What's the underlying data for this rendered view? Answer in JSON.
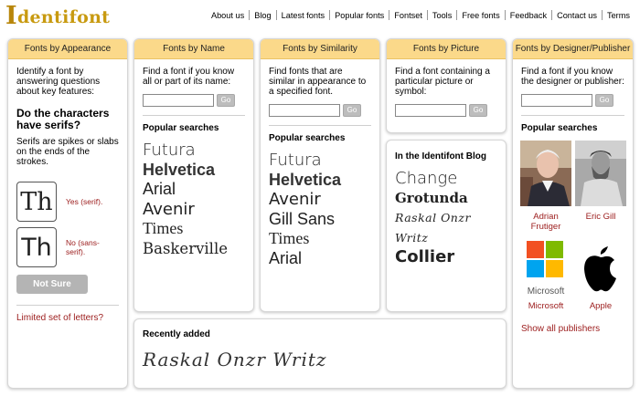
{
  "header": {
    "logo": "Identifont",
    "nav": [
      "About us",
      "Blog",
      "Latest fonts",
      "Popular fonts",
      "Fontset",
      "Tools",
      "Free fonts",
      "Feedback",
      "Contact us",
      "Terms"
    ]
  },
  "appearance": {
    "title": "Fonts by Appearance",
    "intro": "Identify a font by answering questions about key features:",
    "question": "Do the characters have serifs?",
    "definition": "Serifs are spikes or slabs on the ends of the strokes.",
    "sample_text": "Th",
    "yes_label": "Yes (serif).",
    "no_label": "No (sans-serif).",
    "not_sure": "Not Sure",
    "limited_link": "Limited set of letters?"
  },
  "name": {
    "title": "Fonts by Name",
    "intro": "Find a font if you know all or part of its name:",
    "go": "Go",
    "popular_title": "Popular searches",
    "popular": [
      "Futura",
      "Helvetica",
      "Arial",
      "Avenir",
      "Times",
      "Baskerville"
    ]
  },
  "similarity": {
    "title": "Fonts by Similarity",
    "intro": "Find fonts that are similar in appearance to a specified font.",
    "go": "Go",
    "popular_title": "Popular searches",
    "popular": [
      "Futura",
      "Helvetica",
      "Avenir",
      "Gill Sans",
      "Times",
      "Arial"
    ]
  },
  "picture": {
    "title": "Fonts by Picture",
    "intro": "Find a font containing a particular picture or symbol:",
    "go": "Go"
  },
  "blog": {
    "title": "In the Identifont Blog",
    "items": [
      "Change",
      "Grotunda",
      "Raskal Onzr Writz",
      "Collier"
    ]
  },
  "recent": {
    "title": "Recently added",
    "font": "Raskal Onzr Writz"
  },
  "designer": {
    "title": "Fonts by Designer/Publisher",
    "intro": "Find a font if you know the designer or publisher:",
    "go": "Go",
    "popular_title": "Popular searches",
    "people": [
      "Adrian Frutiger",
      "Eric Gill"
    ],
    "publishers": [
      "Microsoft",
      "Apple"
    ],
    "microsoft_logo_text": "Microsoft",
    "show_all": "Show all publishers"
  },
  "colors": {
    "panel_header": "#fbd98a",
    "link_red": "#9b1b1b",
    "ms_red": "#f25022",
    "ms_green": "#7fba00",
    "ms_blue": "#00a4ef",
    "ms_yellow": "#ffb900"
  }
}
